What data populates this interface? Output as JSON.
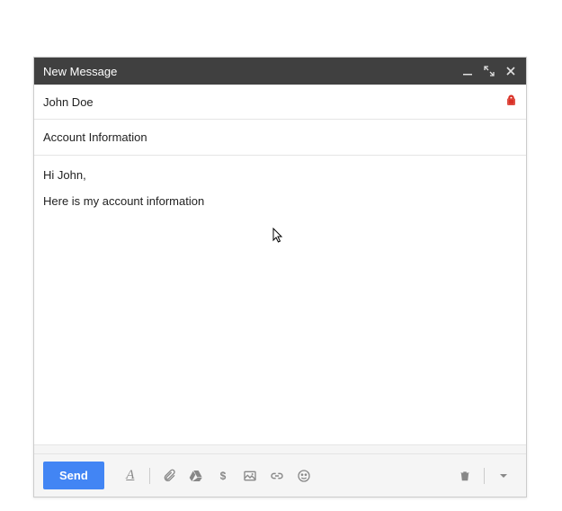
{
  "header": {
    "title": "New Message"
  },
  "to": {
    "recipient": "John Doe"
  },
  "subject": {
    "value": "Account Information"
  },
  "body": {
    "line1": "Hi John,",
    "line2": "Here is my account information"
  },
  "toolbar": {
    "send_label": "Send"
  }
}
